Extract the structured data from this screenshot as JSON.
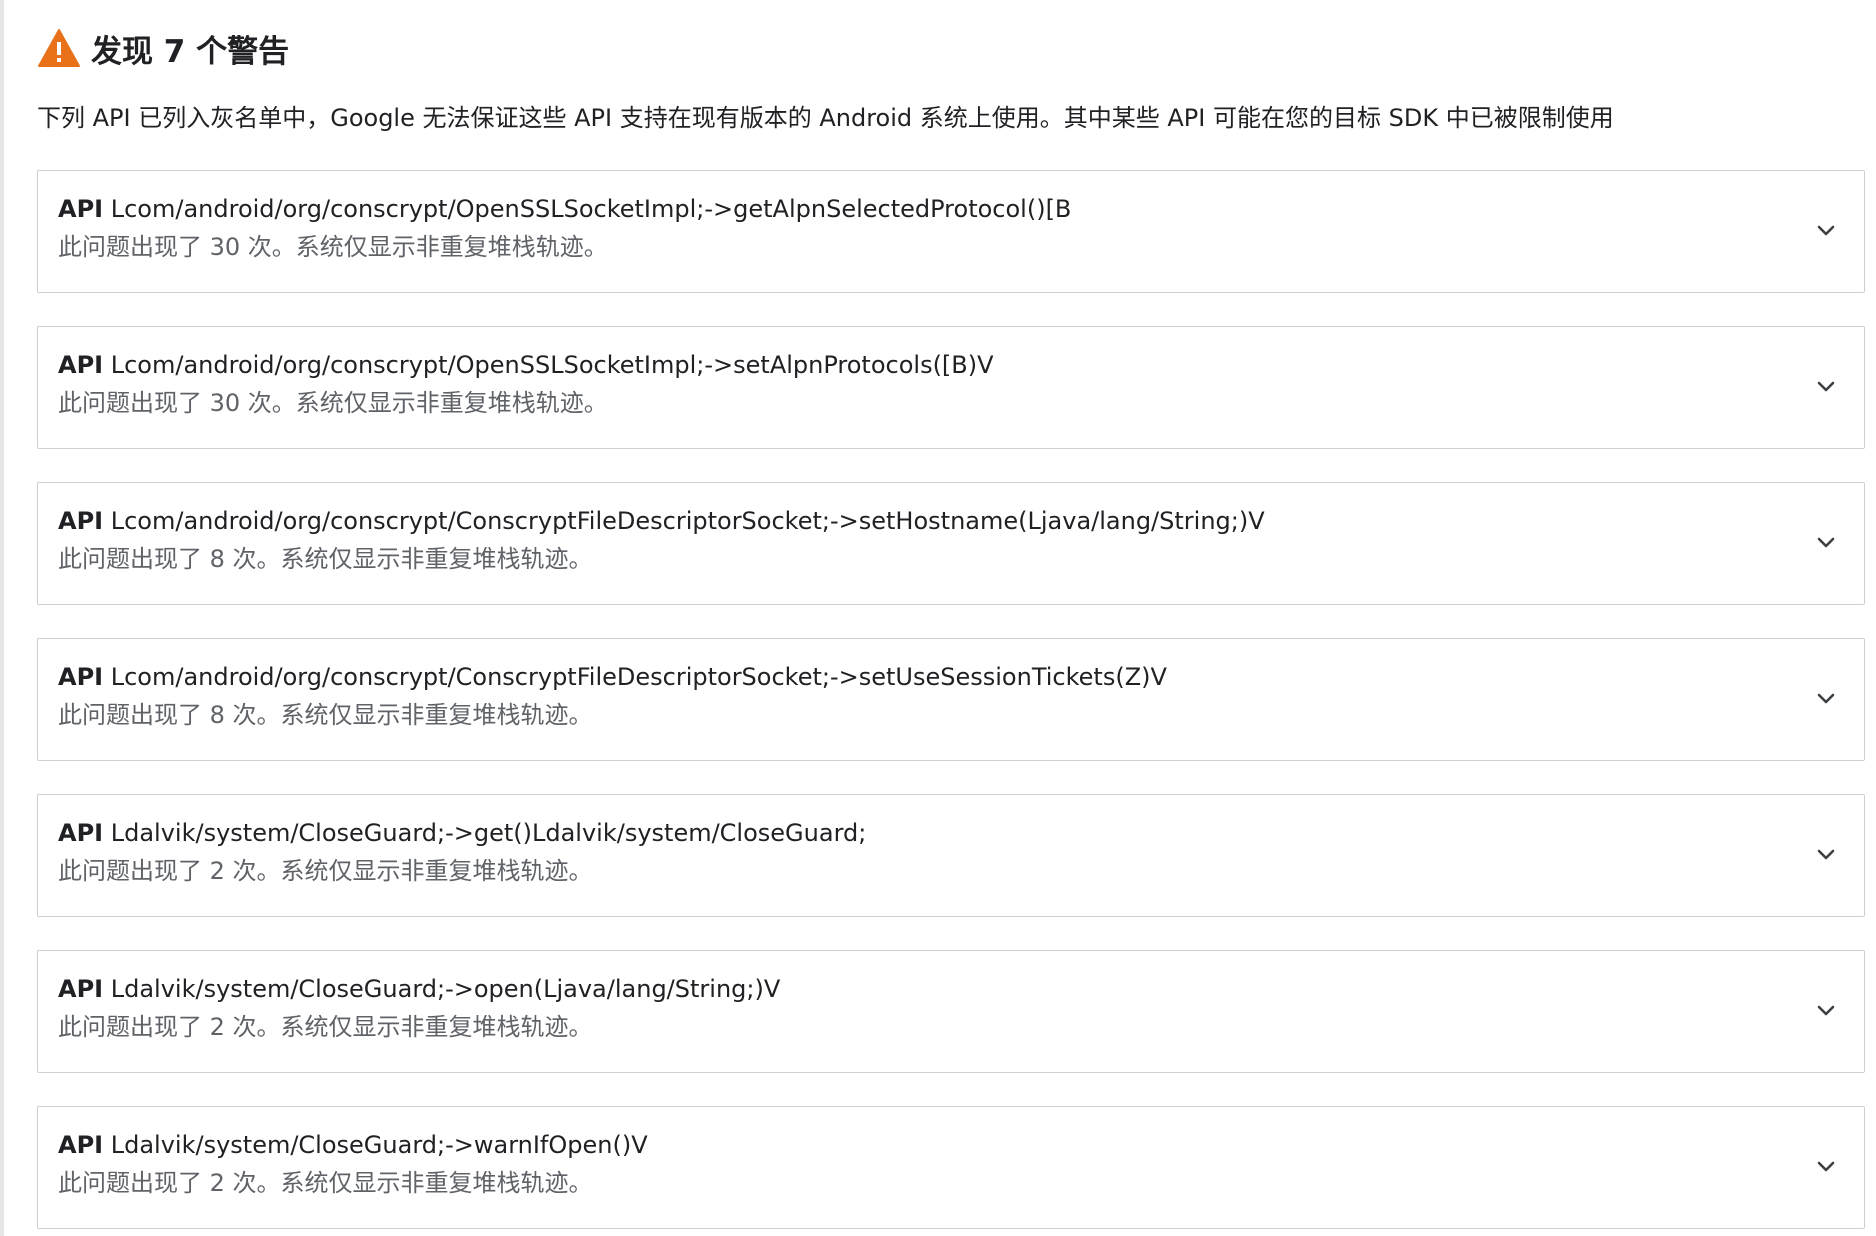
{
  "header": {
    "icon": "warning-triangle-icon",
    "title": "发现 7 个警告",
    "warning_color": "#e8711a"
  },
  "description": "下列 API 已列入灰名单中，Google 无法保证这些 API 支持在现有版本的 Android 系统上使用。其中某些 API 可能在您的目标 SDK 中已被限制使用",
  "warnings": [
    {
      "prefix": "API",
      "api": "Lcom/android/org/conscrypt/OpenSSLSocketImpl;->getAlpnSelectedProtocol()[B",
      "count_text": "此问题出现了 30 次。系统仅显示非重复堆栈轨迹。",
      "icon": "chevron-down-icon"
    },
    {
      "prefix": "API",
      "api": "Lcom/android/org/conscrypt/OpenSSLSocketImpl;->setAlpnProtocols([B)V",
      "count_text": "此问题出现了 30 次。系统仅显示非重复堆栈轨迹。",
      "icon": "chevron-down-icon"
    },
    {
      "prefix": "API",
      "api": "Lcom/android/org/conscrypt/ConscryptFileDescriptorSocket;->setHostname(Ljava/lang/String;)V",
      "count_text": "此问题出现了 8 次。系统仅显示非重复堆栈轨迹。",
      "icon": "chevron-down-icon"
    },
    {
      "prefix": "API",
      "api": "Lcom/android/org/conscrypt/ConscryptFileDescriptorSocket;->setUseSessionTickets(Z)V",
      "count_text": "此问题出现了 8 次。系统仅显示非重复堆栈轨迹。",
      "icon": "chevron-down-icon"
    },
    {
      "prefix": "API",
      "api": "Ldalvik/system/CloseGuard;->get()Ldalvik/system/CloseGuard;",
      "count_text": "此问题出现了 2 次。系统仅显示非重复堆栈轨迹。",
      "icon": "chevron-down-icon"
    },
    {
      "prefix": "API",
      "api": "Ldalvik/system/CloseGuard;->open(Ljava/lang/String;)V",
      "count_text": "此问题出现了 2 次。系统仅显示非重复堆栈轨迹。",
      "icon": "chevron-down-icon"
    },
    {
      "prefix": "API",
      "api": "Ldalvik/system/CloseGuard;->warnIfOpen()V",
      "count_text": "此问题出现了 2 次。系统仅显示非重复堆栈轨迹。",
      "icon": "chevron-down-icon"
    }
  ]
}
